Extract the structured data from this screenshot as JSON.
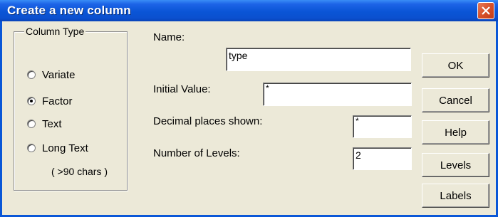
{
  "window": {
    "title": "Create a new column"
  },
  "column_type": {
    "legend": "Column Type",
    "options": [
      {
        "label": "Variate",
        "checked": false
      },
      {
        "label": "Factor",
        "checked": true
      },
      {
        "label": "Text",
        "checked": false
      },
      {
        "label": "Long Text",
        "checked": false
      }
    ],
    "long_text_note": "( >90 chars )"
  },
  "fields": {
    "name_label": "Name:",
    "name_value": "type",
    "initial_value_label": "Initial Value:",
    "initial_value": "*",
    "decimal_label": "Decimal places shown:",
    "decimal_value": "*",
    "levels_label": "Number of Levels:",
    "levels_value": "2"
  },
  "buttons": {
    "ok": "OK",
    "cancel": "Cancel",
    "help": "Help",
    "levels": "Levels",
    "labels": "Labels"
  },
  "colors": {
    "title_bar": "#0a55d6",
    "dialog_bg": "#ece9d8",
    "close_button": "#d7502a"
  }
}
